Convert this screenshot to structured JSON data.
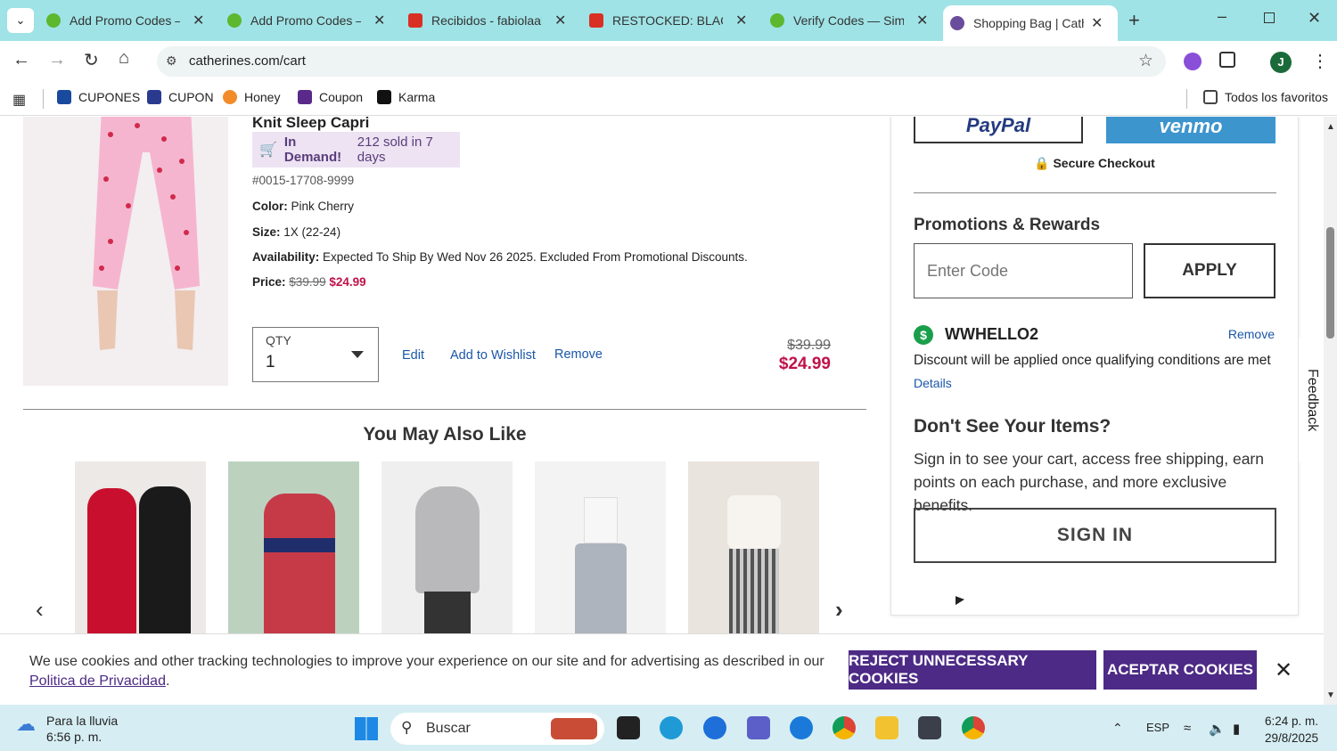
{
  "browser": {
    "tabs": [
      {
        "title": "Add Promo Codes —",
        "favicon_color": "#5cb82e",
        "active": false
      },
      {
        "title": "Add Promo Codes —",
        "favicon_color": "#5cb82e",
        "active": false
      },
      {
        "title": "Recibidos - fabiolaale",
        "favicon_color": "#d93025",
        "active": false
      },
      {
        "title": "RESTOCKED: BLAC",
        "favicon_color": "#ff7a1a",
        "active": false
      },
      {
        "title": "Verify Codes — Simp",
        "favicon_color": "#5cb82e",
        "active": false
      },
      {
        "title": "Shopping Bag | Cathe",
        "favicon_color": "#6a4c9c",
        "active": true
      }
    ],
    "url": "catherines.com/cart",
    "bookmarks": [
      "CUPONES",
      "CUPON",
      "Honey",
      "Coupon",
      "Karma"
    ],
    "all_bookmarks": "Todos los favoritos",
    "profile_initial": "J"
  },
  "product": {
    "name": "Knit Sleep Capri",
    "demand_label": "In Demand!",
    "demand_text": "212 sold in 7 days",
    "sku": "#0015-17708-9999",
    "color_label": "Color:",
    "color_value": "Pink Cherry",
    "size_label": "Size:",
    "size_value": "1X (22-24)",
    "availability_label": "Availability:",
    "availability_value": "Expected To Ship By Wed Nov 26 2025. Excluded From Promotional Discounts.",
    "price_label": "Price:",
    "price_original": "$39.99",
    "price_sale": "$24.99",
    "qty_label": "QTY",
    "qty_value": "1",
    "edit_label": "Edit",
    "wishlist_label": "Add to Wishlist",
    "remove_label": "Remove",
    "total_original": "$39.99",
    "total_sale": "$24.99"
  },
  "recommendations": {
    "title": "You May Also Like"
  },
  "checkout": {
    "paypal_label": "PayPal",
    "venmo_label": "venmo",
    "secure_label": "Secure Checkout",
    "promo_title": "Promotions & Rewards",
    "code_placeholder": "Enter Code",
    "apply_label": "APPLY",
    "coupon_code": "WWHELLO2",
    "coupon_remove": "Remove",
    "coupon_message": "Discount will be applied once qualifying conditions are met",
    "details_label": "Details",
    "signin_title": "Don't See Your Items?",
    "signin_text": "Sign in to see your cart, access free shipping, earn points on each purchase, and more exclusive benefits.",
    "signin_button": "SIGN IN",
    "feedback_label": "Feedback"
  },
  "cookie_banner": {
    "text": "We use cookies and other tracking technologies to improve your experience on our site and for advertising as described in our",
    "link": "Politica de Privacidad",
    "reject_label": "REJECT UNNECESSARY COOKIES",
    "accept_label": "ACEPTAR COOKIES"
  },
  "taskbar": {
    "weather_title": "Para la lluvia",
    "weather_time": "6:56 p. m.",
    "search_placeholder": "Buscar",
    "language": "ESP",
    "time": "6:24 p. m.",
    "date": "29/8/2025"
  },
  "colors": {
    "chrome": "#9fe3e6",
    "brand_purple": "#4c2a85",
    "sale_red": "#c0124a",
    "link_blue": "#1a56a8"
  }
}
